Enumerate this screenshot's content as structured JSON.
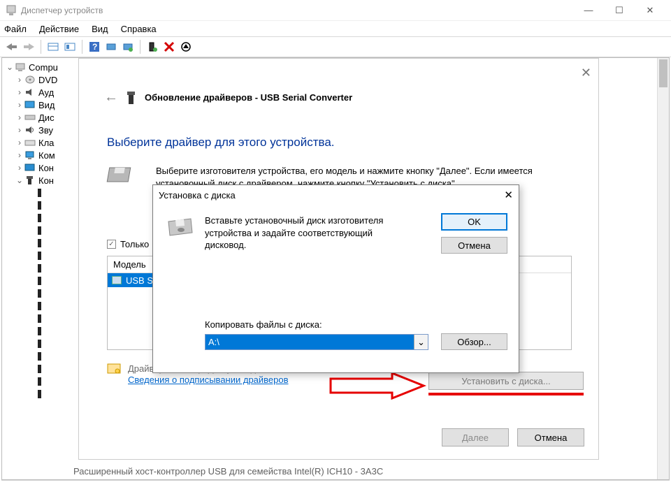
{
  "window": {
    "title": "Диспетчер устройств",
    "controls": {
      "min": "—",
      "max": "☐",
      "close": "✕"
    }
  },
  "menubar": {
    "file": "Файл",
    "action": "Действие",
    "view": "Вид",
    "help": "Справка"
  },
  "tree": {
    "root": "Compu",
    "items": [
      {
        "label": "DVD",
        "icon": "disc"
      },
      {
        "label": "Ауд",
        "icon": "speaker"
      },
      {
        "label": "Вид",
        "icon": "monitor"
      },
      {
        "label": "Дис",
        "icon": "drive"
      },
      {
        "label": "Зву",
        "icon": "audio"
      },
      {
        "label": "Кла",
        "icon": "keyboard"
      },
      {
        "label": "Ком",
        "icon": "desktop"
      },
      {
        "label": "Кон",
        "icon": "display"
      },
      {
        "label": "Кон",
        "icon": "usb",
        "expanded": true
      }
    ]
  },
  "wizard": {
    "header_prefix": "Обновление драйверов - ",
    "header_device": "USB Serial Converter",
    "prompt": "Выберите драйвер для этого устройства.",
    "compat_text_1": "Выберите изготовителя устройства, его модель и нажмите кнопку \"Далее\". Если имеется",
    "compat_text_2": "установочный диск с драйвером, нажмите кнопку \"Установить с диска\".",
    "only_compatible": "Только",
    "model_header": "Модель",
    "model_item": "USB S",
    "sig_line1": "Драйвер имеет цифровую подпись.",
    "sig_line2": "Сведения о подписывании драйверов",
    "install_from_disk": "Установить с диска...",
    "next": "Далее",
    "cancel": "Отмена"
  },
  "install_dialog": {
    "title": "Установка с диска",
    "instruction": "Вставьте установочный диск изготовителя устройства и задайте соответствующий дисковод.",
    "ok": "OK",
    "cancel": "Отмена",
    "copy_label": "Копировать файлы с диска:",
    "path": "A:\\",
    "browse": "Обзор..."
  },
  "partial_bottom": "Расширенный хост-контроллер USB для семейства Intel(R) ICH10 - 3A3C"
}
